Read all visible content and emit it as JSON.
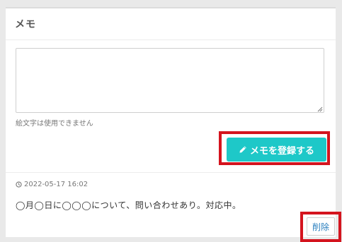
{
  "panel": {
    "title": "メモ"
  },
  "form": {
    "textarea_value": "",
    "hint": "絵文字は使用できません",
    "register_label": "メモを登録する",
    "register_icon": "pencil-icon",
    "accent_color": "#1ec8c8",
    "highlight_color": "#d4141e"
  },
  "memos": [
    {
      "timestamp": "2022-05-17 16:02",
      "text": "◯月◯日に◯◯◯について、問い合わせあり。対応中。",
      "delete_label": "削除"
    }
  ]
}
